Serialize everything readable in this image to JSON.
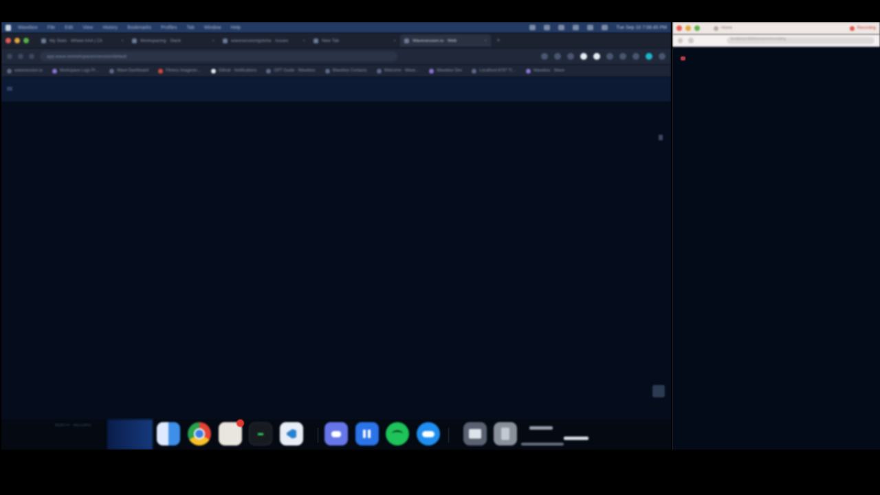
{
  "menubar": {
    "app_name": "Wavebox",
    "items": [
      "File",
      "Edit",
      "View",
      "History",
      "Bookmarks",
      "Profiles",
      "Tab",
      "Window",
      "Help"
    ],
    "clock": "Tue Sep 10  7:08:45 PM"
  },
  "tabs": [
    {
      "label": "My Stats · Wheel AAA | Cli",
      "active": false
    },
    {
      "label": "Workspacing · Slack",
      "active": false
    },
    {
      "label": "wavesession/gotcha · Issues",
      "active": false
    },
    {
      "label": "New Tab",
      "active": false
    },
    {
      "label": "Wavesession.io · Web",
      "active": true
    }
  ],
  "omnibox": {
    "url": "app.wave.io/workspaces/session/default"
  },
  "bookmarks": [
    {
      "label": "wavesession.io",
      "color": "default"
    },
    {
      "label": "Workspace Logs Pr…",
      "color": "purple"
    },
    {
      "label": "Wave Dashboard",
      "color": "default"
    },
    {
      "label": "Fitness Imagesto…",
      "color": "red"
    },
    {
      "label": "Github · Notifications",
      "color": "white"
    },
    {
      "label": "GPT Guide · Wavebox",
      "color": "default"
    },
    {
      "label": "Wavebox Contacts",
      "color": "default"
    },
    {
      "label": "Welcome · Wave…",
      "color": "default"
    },
    {
      "label": "Wavebox Dev",
      "color": "purple"
    },
    {
      "label": "Localhost:8787 Tt…",
      "color": "default"
    },
    {
      "label": "Wavebox · Wave",
      "color": "purple"
    }
  ],
  "dock": {
    "left_text": "NORTH · RECORD",
    "apps": [
      "finder",
      "chrome",
      "safari",
      "terminal",
      "vscode",
      "discord",
      "app-store",
      "spotify",
      "cloud",
      "folder",
      "trash"
    ],
    "badge_count": ""
  },
  "right_window": {
    "tabs": [
      {
        "label": "Home"
      },
      {
        "label": "Recording"
      }
    ],
    "omnibox": "localhost:3000/session/recording"
  },
  "colors": {
    "page_bg": "#050d1c",
    "menubar": "#233a63",
    "header": "#0d1a33",
    "right_chrome": "#efe7e4"
  }
}
